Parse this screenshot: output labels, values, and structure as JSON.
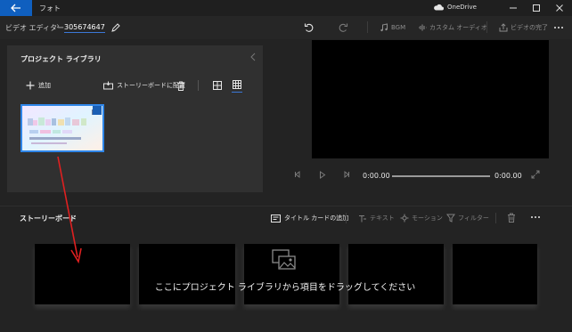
{
  "app": {
    "title": "フォト",
    "onedrive": "OneDrive"
  },
  "breadcrumb": {
    "root": "ビデオ エディター",
    "separator": "›",
    "project": "305674647"
  },
  "toolbar": {
    "bgm": "BGM",
    "custom_audio": "カスタム オーディオ",
    "finish": "ビデオの完了"
  },
  "library": {
    "title": "プロジェクト ライブラリ",
    "add": "追加",
    "place_on_storyboard": "ストーリーボードに配置"
  },
  "player": {
    "current_time": "0:00.00",
    "end_time": "0:00.00"
  },
  "storyboard": {
    "title": "ストーリーボード",
    "add_title_card": "タイトル カードの追加",
    "text": "テキスト",
    "motion": "モーション",
    "filter": "フィルター",
    "drag_hint": "ここにプロジェクト ライブラリから項目をドラッグしてください"
  },
  "colors": {
    "accent": "#0f5fbf",
    "selection": "#2f86e8",
    "arrow": "#e02020"
  }
}
